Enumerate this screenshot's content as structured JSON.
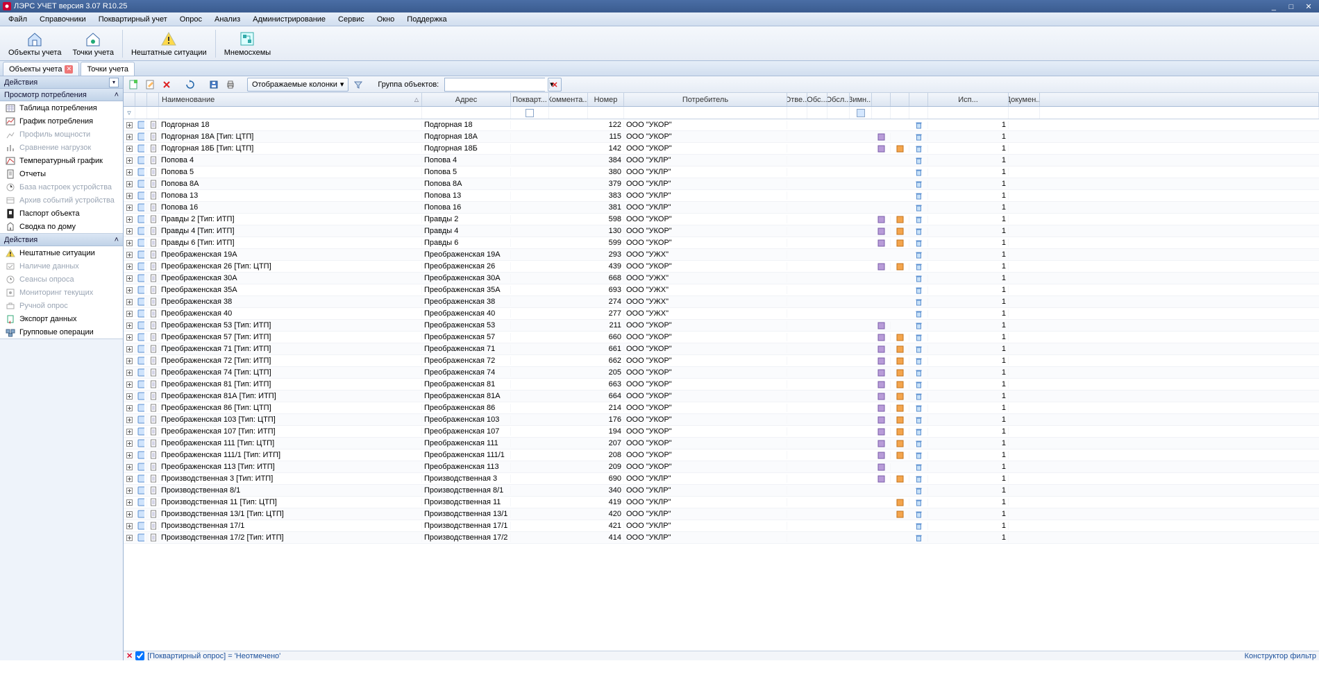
{
  "app": {
    "title": "ЛЭРС УЧЕТ версия 3.07 R10.25"
  },
  "menu": [
    "Файл",
    "Справочники",
    "Поквартирный учет",
    "Опрос",
    "Анализ",
    "Администрирование",
    "Сервис",
    "Окно",
    "Поддержка"
  ],
  "bigbar": {
    "b1": "Объекты учета",
    "b2": "Точки учета",
    "b3": "Нештатные ситуации",
    "b4": "Мнемосхемы"
  },
  "tabs": {
    "t1": "Объекты учета",
    "t2": "Точки учета"
  },
  "toolrow": {
    "displayed_cols": "Отображаемые колонки",
    "group_label": "Группа объектов:"
  },
  "sidebar": {
    "hdr": "Действия",
    "g1title": "Просмотр потребления",
    "g1": [
      "Таблица потребления",
      "График потребления",
      "Профиль мощности",
      "Сравнение нагрузок",
      "Температурный график",
      "Отчеты",
      "База настроек устройства",
      "Архив событий устройства",
      "Паспорт объекта",
      "Сводка по дому"
    ],
    "g1disabled": [
      false,
      false,
      true,
      true,
      false,
      false,
      true,
      true,
      false,
      false
    ],
    "g2title": "Действия",
    "g2": [
      "Нештатные ситуации",
      "Наличие данных",
      "Сеансы опроса",
      "Мониторинг текущих",
      "Ручной опрос",
      "Экспорт данных",
      "Групповые операции"
    ],
    "g2disabled": [
      false,
      true,
      true,
      true,
      true,
      false,
      false
    ]
  },
  "columns": {
    "name": "Наименование",
    "addr": "Адрес",
    "pokv": "Покварт...",
    "comm": "Коммента...",
    "num": "Номер",
    "cons": "Потребитель",
    "otv": "Отве...",
    "obs1": "Обс...",
    "obs2": "Обсл...",
    "zim": "Зимн...",
    "isp": "Исп...",
    "doc": "Докумен..."
  },
  "rows": [
    {
      "name": "Подгорная 18",
      "addr": "Подгорная 18",
      "num": "122",
      "cons": "ООО \"УКОР\"",
      "i3": true,
      "isp": "1"
    },
    {
      "name": "Подгорная 18А [Тип: ЦТП]",
      "addr": "Подгорная 18А",
      "num": "115",
      "cons": "ООО \"УКОР\"",
      "i1": true,
      "i3": true,
      "isp": "1"
    },
    {
      "name": "Подгорная 18Б [Тип: ЦТП]",
      "addr": "Подгорная 18Б",
      "num": "142",
      "cons": "ООО \"УКОР\"",
      "i1": true,
      "i2": true,
      "i3": true,
      "isp": "1"
    },
    {
      "name": "Попова 4",
      "addr": "Попова 4",
      "num": "384",
      "cons": "ООО \"УКЛР\"",
      "i3": true,
      "isp": "1"
    },
    {
      "name": "Попова 5",
      "addr": "Попова 5",
      "num": "380",
      "cons": "ООО \"УКЛР\"",
      "i3": true,
      "isp": "1"
    },
    {
      "name": "Попова 8А",
      "addr": "Попова 8А",
      "num": "379",
      "cons": "ООО \"УКЛР\"",
      "i3": true,
      "isp": "1"
    },
    {
      "name": "Попова 13",
      "addr": "Попова 13",
      "num": "383",
      "cons": "ООО \"УКЛР\"",
      "i3": true,
      "isp": "1"
    },
    {
      "name": "Попова 16",
      "addr": "Попова 16",
      "num": "381",
      "cons": "ООО \"УКЛР\"",
      "i3": true,
      "isp": "1"
    },
    {
      "name": "Правды 2 [Тип: ИТП]",
      "addr": "Правды 2",
      "num": "598",
      "cons": "ООО \"УКОР\"",
      "i1": true,
      "i2": true,
      "i3": true,
      "isp": "1"
    },
    {
      "name": "Правды 4 [Тип: ИТП]",
      "addr": "Правды 4",
      "num": "130",
      "cons": "ООО \"УКОР\"",
      "i1": true,
      "i2": true,
      "i3": true,
      "isp": "1"
    },
    {
      "name": "Правды 6 [Тип: ИТП]",
      "addr": "Правды 6",
      "num": "599",
      "cons": "ООО \"УКОР\"",
      "i1": true,
      "i2": true,
      "i3": true,
      "isp": "1"
    },
    {
      "name": "Преображенская 19А",
      "addr": "Преображенская 19А",
      "num": "293",
      "cons": "ООО \"УЖХ\"",
      "i3": true,
      "isp": "1"
    },
    {
      "name": "Преображенская 26 [Тип: ЦТП]",
      "addr": "Преображенская 26",
      "num": "439",
      "cons": "ООО \"УКОР\"",
      "i1": true,
      "i2": true,
      "i3": true,
      "isp": "1"
    },
    {
      "name": "Преображенская 30А",
      "addr": "Преображенская 30А",
      "num": "668",
      "cons": "ООО \"УЖХ\"",
      "i3": true,
      "isp": "1"
    },
    {
      "name": "Преображенская 35А",
      "addr": "Преображенская 35А",
      "num": "693",
      "cons": "ООО \"УЖХ\"",
      "i3": true,
      "isp": "1"
    },
    {
      "name": "Преображенская 38",
      "addr": "Преображенская 38",
      "num": "274",
      "cons": "ООО \"УЖХ\"",
      "i3": true,
      "isp": "1"
    },
    {
      "name": "Преображенская 40",
      "addr": "Преображенская 40",
      "num": "277",
      "cons": "ООО \"УЖХ\"",
      "i3": true,
      "isp": "1"
    },
    {
      "name": "Преображенская 53 [Тип: ИТП]",
      "addr": "Преображенская 53",
      "num": "211",
      "cons": "ООО \"УКОР\"",
      "i1": true,
      "i3": true,
      "isp": "1"
    },
    {
      "name": "Преображенская 57 [Тип: ИТП]",
      "addr": "Преображенская 57",
      "num": "660",
      "cons": "ООО \"УКОР\"",
      "i1": true,
      "i2": true,
      "i3": true,
      "isp": "1"
    },
    {
      "name": "Преображенская 71 [Тип: ИТП]",
      "addr": "Преображенская 71",
      "num": "661",
      "cons": "ООО \"УКОР\"",
      "i1": true,
      "i2": true,
      "i3": true,
      "isp": "1"
    },
    {
      "name": "Преображенская 72 [Тип: ИТП]",
      "addr": "Преображенская 72",
      "num": "662",
      "cons": "ООО \"УКОР\"",
      "i1": true,
      "i2": true,
      "i3": true,
      "isp": "1"
    },
    {
      "name": "Преображенская 74 [Тип: ЦТП]",
      "addr": "Преображенская 74",
      "num": "205",
      "cons": "ООО \"УКОР\"",
      "i1": true,
      "i2": true,
      "i3": true,
      "isp": "1"
    },
    {
      "name": "Преображенская 81 [Тип: ИТП]",
      "addr": "Преображенская 81",
      "num": "663",
      "cons": "ООО \"УКОР\"",
      "i1": true,
      "i2": true,
      "i3": true,
      "isp": "1"
    },
    {
      "name": "Преображенская 81А [Тип: ИТП]",
      "addr": "Преображенская 81А",
      "num": "664",
      "cons": "ООО \"УКОР\"",
      "i1": true,
      "i2": true,
      "i3": true,
      "isp": "1"
    },
    {
      "name": "Преображенская 86 [Тип: ЦТП]",
      "addr": "Преображенская 86",
      "num": "214",
      "cons": "ООО \"УКОР\"",
      "i1": true,
      "i2": true,
      "i3": true,
      "isp": "1"
    },
    {
      "name": "Преображенская 103 [Тип: ЦТП]",
      "addr": "Преображенская 103",
      "num": "176",
      "cons": "ООО \"УКОР\"",
      "i1": true,
      "i2": true,
      "i3": true,
      "isp": "1"
    },
    {
      "name": "Преображенская 107 [Тип: ИТП]",
      "addr": "Преображенская 107",
      "num": "194",
      "cons": "ООО \"УКОР\"",
      "i1": true,
      "i2": true,
      "i3": true,
      "isp": "1"
    },
    {
      "name": "Преображенская 111 [Тип: ЦТП]",
      "addr": "Преображенская 111",
      "num": "207",
      "cons": "ООО \"УКОР\"",
      "i1": true,
      "i2": true,
      "i3": true,
      "isp": "1"
    },
    {
      "name": "Преображенская 111/1 [Тип: ИТП]",
      "addr": "Преображенская 111/1",
      "num": "208",
      "cons": "ООО \"УКОР\"",
      "i1": true,
      "i2": true,
      "i3": true,
      "isp": "1"
    },
    {
      "name": "Преображенская 113 [Тип: ИТП]",
      "addr": "Преображенская 113",
      "num": "209",
      "cons": "ООО \"УКОР\"",
      "i1": true,
      "i3": true,
      "isp": "1"
    },
    {
      "name": "Производственная 3 [Тип: ИТП]",
      "addr": "Производственная 3",
      "num": "690",
      "cons": "ООО \"УКЛР\"",
      "i1": true,
      "i2": true,
      "i3": true,
      "isp": "1"
    },
    {
      "name": "Производственная 8/1",
      "addr": "Производственная 8/1",
      "num": "340",
      "cons": "ООО \"УКЛР\"",
      "i3": true,
      "isp": "1"
    },
    {
      "name": "Производственная 11 [Тип: ЦТП]",
      "addr": "Производственная 11",
      "num": "419",
      "cons": "ООО \"УКЛР\"",
      "i2": true,
      "i3": true,
      "isp": "1"
    },
    {
      "name": "Производственная 13/1 [Тип: ЦТП]",
      "addr": "Производственная 13/1",
      "num": "420",
      "cons": "ООО \"УКЛР\"",
      "i2": true,
      "i3": true,
      "isp": "1"
    },
    {
      "name": "Производственная 17/1",
      "addr": "Производственная 17/1",
      "num": "421",
      "cons": "ООО \"УКЛР\"",
      "i3": true,
      "isp": "1"
    },
    {
      "name": "Производственная 17/2 [Тип: ИТП]",
      "addr": "Производственная 17/2",
      "num": "414",
      "cons": "ООО \"УКЛР\"",
      "i3": true,
      "isp": "1"
    }
  ],
  "footer": {
    "filter_text": "[Поквартирный опрос] = 'Неотмечено'",
    "constructor": "Конструктор фильтр"
  }
}
